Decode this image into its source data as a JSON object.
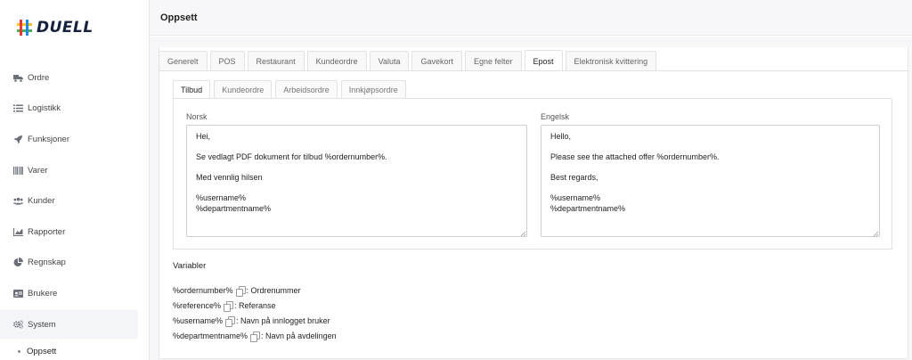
{
  "app": {
    "logo_text": "DUELL",
    "page_title": "Oppsett"
  },
  "sidebar": {
    "items": [
      {
        "label": "Ordre",
        "icon": "truck-icon"
      },
      {
        "label": "Logistikk",
        "icon": "list-icon"
      },
      {
        "label": "Funksjoner",
        "icon": "rocket-icon"
      },
      {
        "label": "Varer",
        "icon": "barcode-icon"
      },
      {
        "label": "Kunder",
        "icon": "users-icon"
      },
      {
        "label": "Rapporter",
        "icon": "chart-icon"
      },
      {
        "label": "Regnskap",
        "icon": "pie-chart-icon"
      },
      {
        "label": "Brukere",
        "icon": "id-card-icon"
      },
      {
        "label": "System",
        "icon": "gears-icon"
      }
    ],
    "sub_item": "Oppsett"
  },
  "tabs": [
    "Generelt",
    "POS",
    "Restaurant",
    "Kundeordre",
    "Valuta",
    "Gavekort",
    "Egne felter",
    "Epost",
    "Elektronisk kvittering"
  ],
  "active_tab": "Epost",
  "subtabs": [
    "Tilbud",
    "Kundeordre",
    "Arbeidsordre",
    "Innkjøpsordre"
  ],
  "active_subtab": "Tilbud",
  "editor": {
    "norsk_label": "Norsk",
    "engelsk_label": "Engelsk",
    "norsk_text": "Hei,\n\nSe vedlagt PDF dokument for tilbud %ordernumber%.\n\nMed vennlig hilsen\n\n%username%\n%departmentname%",
    "engelsk_text": "Hello,\n\nPlease see the attached offer %ordernumber%.\n\nBest regards,\n\n%username%\n%departmentname%"
  },
  "variables": {
    "title": "Variabler",
    "items": [
      {
        "code": "%ordernumber%",
        "desc": ": Ordrenummer"
      },
      {
        "code": "%reference%",
        "desc": ": Referanse"
      },
      {
        "code": "%username%",
        "desc": ": Navn på innlogget bruker"
      },
      {
        "code": "%departmentname%",
        "desc": ": Navn på avdelingen"
      }
    ]
  },
  "colors": {
    "brand_navy": "#16213e",
    "logo_green": "#4caf50",
    "logo_red": "#e53935",
    "logo_yellow": "#fbc02d",
    "logo_blue": "#1e88e5"
  }
}
